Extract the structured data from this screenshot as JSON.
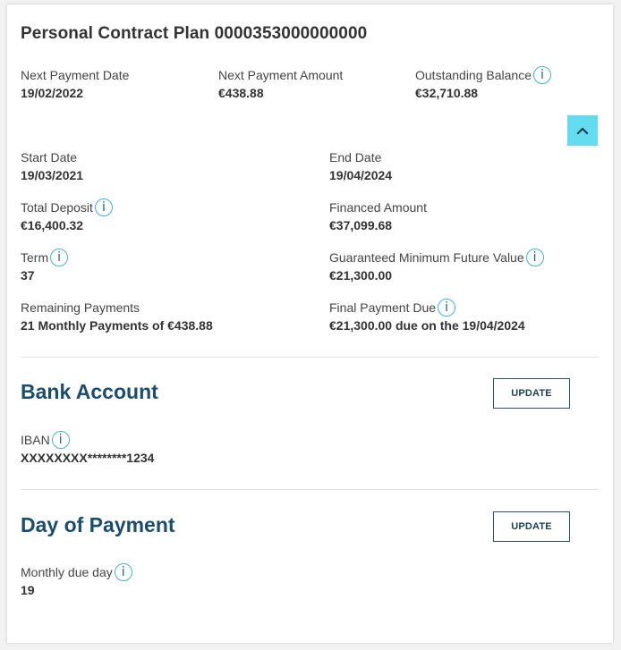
{
  "contract": {
    "title": "Personal Contract Plan 0000353000000000"
  },
  "summary": {
    "next_payment_date_label": "Next Payment Date",
    "next_payment_date_value": "19/02/2022",
    "next_payment_amount_label": "Next Payment Amount",
    "next_payment_amount_value": "€438.88",
    "outstanding_balance_label": "Outstanding Balance",
    "outstanding_balance_value": "€32,710.88"
  },
  "details": {
    "start_date_label": "Start Date",
    "start_date_value": "19/03/2021",
    "end_date_label": "End Date",
    "end_date_value": "19/04/2024",
    "total_deposit_label": "Total Deposit",
    "total_deposit_value": "€16,400.32",
    "financed_amount_label": "Financed Amount",
    "financed_amount_value": "€37,099.68",
    "term_label": "Term",
    "term_value": "37",
    "gmfv_label": "Guaranteed Minimum Future Value",
    "gmfv_value": "€21,300.00",
    "remaining_payments_label": "Remaining Payments",
    "remaining_payments_value": "21 Monthly Payments of €438.88",
    "final_payment_label": "Final Payment Due",
    "final_payment_value": "€21,300.00 due on the 19/04/2024"
  },
  "bank_account": {
    "title": "Bank Account",
    "update_label": "UPDATE",
    "iban_label": "IBAN",
    "iban_value": "XXXXXXXX********1234"
  },
  "day_of_payment": {
    "title": "Day of Payment",
    "update_label": "UPDATE",
    "monthly_due_day_label": "Monthly due day",
    "monthly_due_day_value": "19"
  },
  "icons": {
    "info": "i",
    "collapse": "chevron-up-icon"
  },
  "colors": {
    "accent": "#63dcf0",
    "heading": "#1c4d6b",
    "info_border": "#4ab0d6"
  }
}
